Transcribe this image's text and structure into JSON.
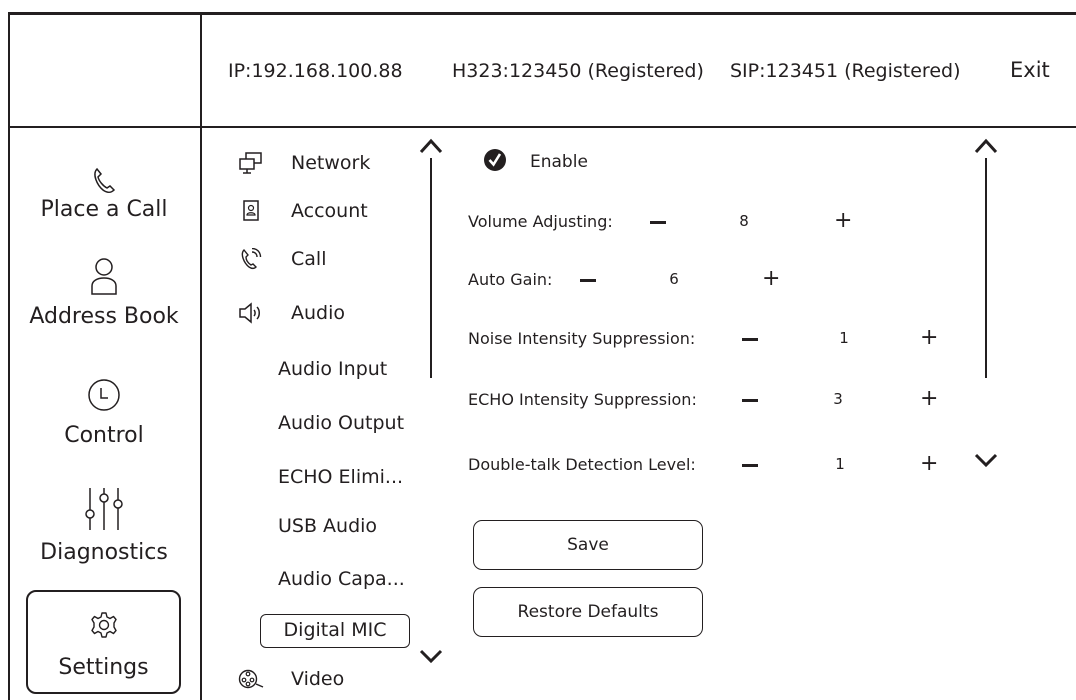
{
  "header": {
    "ip": "IP:192.168.100.88",
    "h323": "H323:123450 (Registered)",
    "sip": "SIP:123451 (Registered)",
    "exit": "Exit"
  },
  "nav": [
    {
      "label": "Place a Call",
      "icon": "phone-icon"
    },
    {
      "label": "Address Book",
      "icon": "person-icon"
    },
    {
      "label": "Control",
      "icon": "clock-icon"
    },
    {
      "label": "Diagnostics",
      "icon": "sliders-icon"
    },
    {
      "label": "Settings",
      "icon": "gear-icon",
      "selected": true
    }
  ],
  "menu": {
    "items": [
      {
        "label": "Network",
        "icon": "network-icon"
      },
      {
        "label": "Account",
        "icon": "account-icon"
      },
      {
        "label": "Call",
        "icon": "call-icon"
      },
      {
        "label": "Audio",
        "icon": "audio-icon"
      }
    ],
    "sub_items": [
      "Audio Input",
      "Audio Output",
      "ECHO Elimi...",
      "USB Audio",
      "Audio Capa...",
      "Digital MIC"
    ],
    "selected_sub": "Digital MIC",
    "last_item": {
      "label": "Video",
      "icon": "video-icon"
    }
  },
  "panel": {
    "enable_label": "Enable",
    "enabled": true,
    "settings": [
      {
        "label": "Volume Adjusting:",
        "value": "8"
      },
      {
        "label": "Auto Gain:",
        "value": "6"
      },
      {
        "label": "Noise Intensity Suppression:",
        "value": "1"
      },
      {
        "label": "ECHO Intensity Suppression:",
        "value": "3"
      },
      {
        "label": "Double-talk Detection Level:",
        "value": "1"
      }
    ],
    "save_label": "Save",
    "restore_label": "Restore Defaults"
  }
}
